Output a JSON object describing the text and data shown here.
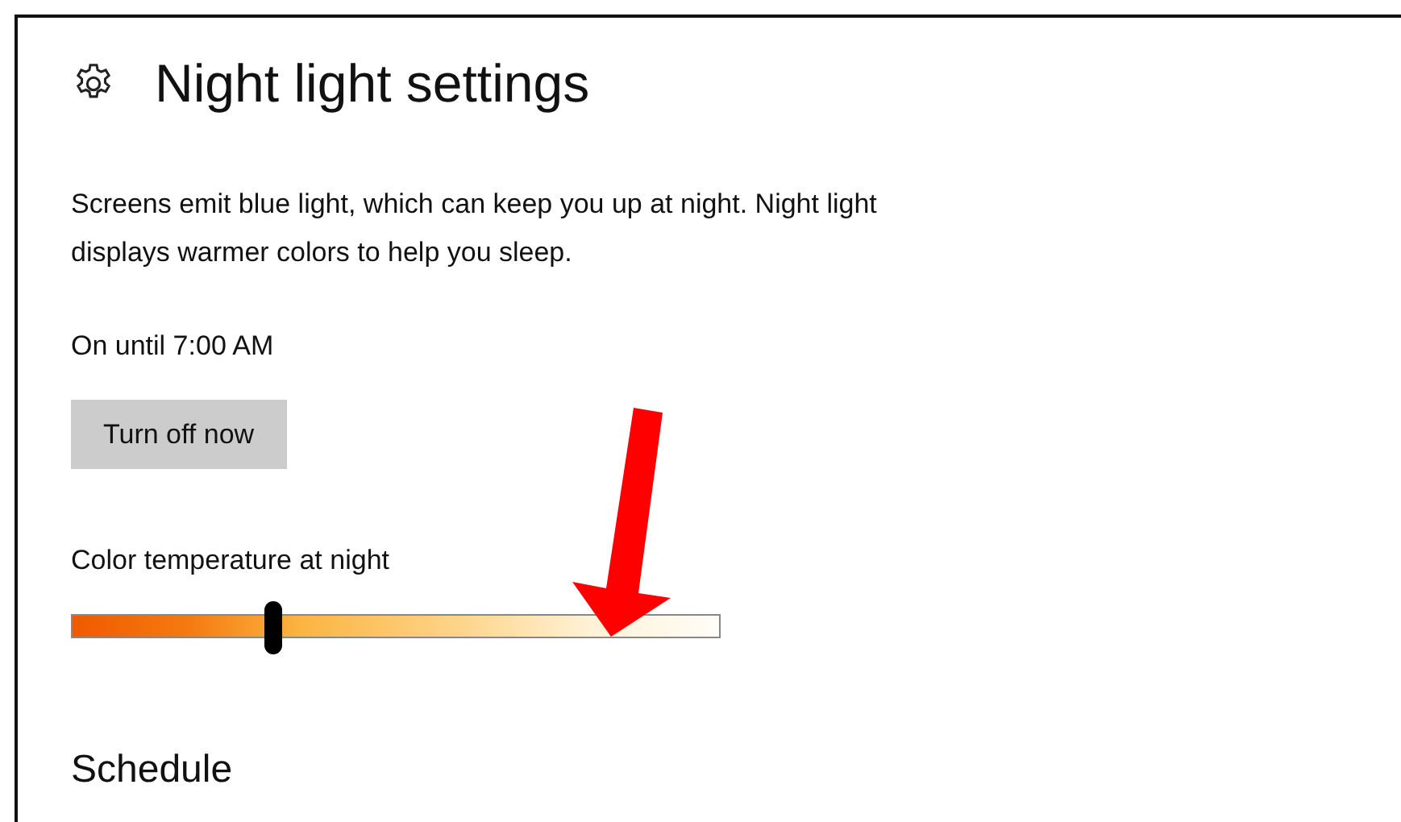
{
  "page": {
    "title": "Night light settings"
  },
  "description": "Screens emit blue light, which can keep you up at night. Night light displays warmer colors to help you sleep.",
  "status": "On until 7:00 AM",
  "button": {
    "label": "Turn off now"
  },
  "color_temperature": {
    "label": "Color temperature at night",
    "level": 0.31
  },
  "schedule": {
    "heading": "Schedule"
  }
}
